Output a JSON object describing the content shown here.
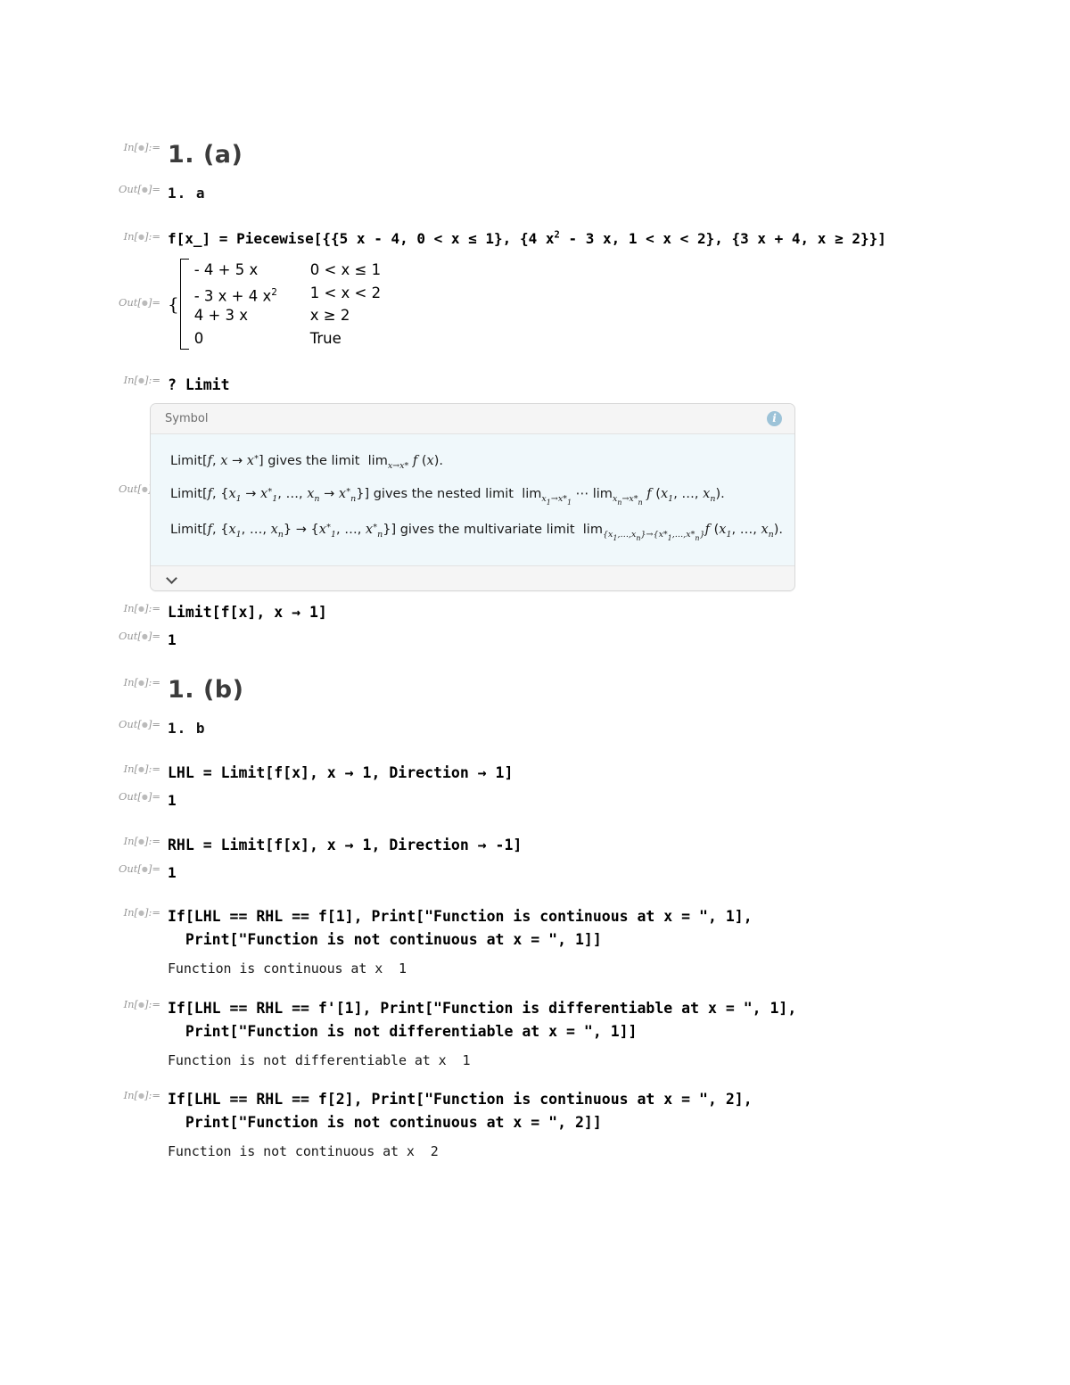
{
  "notebook": {
    "in_label": "In[",
    "out_label": "Out[",
    "label_suffix_in": "]:=",
    "label_suffix_out": "]="
  },
  "cells": {
    "title_a_in": "1. (a)",
    "title_a_out": "1. a",
    "piecewise_in": "f[x_] = Piecewise[{{5 x - 4, 0 < x ≤ 1}, {4 x² - 3 x, 1 < x < 2}, {3 x + 4, x ≥ 2}}]",
    "piecewise_out": {
      "rows": [
        {
          "expr": "- 4 + 5 x",
          "cond": "0 < x ≤ 1"
        },
        {
          "expr": "- 3 x + 4 x",
          "expr_sup": "2",
          "cond": "1 < x < 2"
        },
        {
          "expr": "4 + 3 x",
          "cond": "x ≥ 2"
        },
        {
          "expr": "0",
          "cond": "True"
        }
      ]
    },
    "help_in": "? Limit",
    "limit_in": "Limit[f[x], x → 1]",
    "limit_out": "1",
    "title_b_in": "1. (b)",
    "title_b_out": "1. b",
    "lhl_in": "LHL = Limit[f[x], x → 1, Direction → 1]",
    "lhl_out": "1",
    "rhl_in": "RHL = Limit[f[x], x → 1, Direction → -1]",
    "rhl_out": "1",
    "if_cont1_in_line1": "If[LHL == RHL == f[1], Print[\"Function is continuous at x = \", 1],",
    "if_cont1_in_line2": "  Print[\"Function is not continuous at x = \", 1]]",
    "if_cont1_print": "Function is continuous at x  1",
    "if_diff_in_line1": "If[LHL == RHL == f'[1], Print[\"Function is differentiable at x = \", 1],",
    "if_diff_in_line2": "  Print[\"Function is not differentiable at x = \", 1]]",
    "if_diff_print": "Function is not differentiable at x  1",
    "if_cont2_in_line1": "If[LHL == RHL == f[2], Print[\"Function is continuous at x = \", 2],",
    "if_cont2_in_line2": "  Print[\"Function is not continuous at x = \", 2]]",
    "if_cont2_print": "Function is not continuous at x  2"
  },
  "docbox": {
    "header_label": "Symbol",
    "info_icon": "info-icon",
    "expand_icon": "chevron-down-icon",
    "lines": [
      {
        "id": "single-limit",
        "text": "Limit[f, x → x*] gives the limit  lim_{x→x*} f (x)."
      },
      {
        "id": "nested-limit",
        "text": "Limit[f, {x₁ → x*₁, …, xₙ → x*ₙ}] gives the nested limit  lim_{x₁→x*₁} ⋯ lim_{xₙ→x*ₙ} f (x₁, …, xₙ)."
      },
      {
        "id": "multivariate-limit",
        "text": "Limit[f, {x₁, …, xₙ} → {x*₁, …, x*ₙ}] gives the multivariate limit  lim_{{x₁,…,xₙ}→{x*₁,…,x*ₙ}} f (x₁, …, xₙ)."
      }
    ]
  },
  "colors": {
    "doc_body_bg": "#f0f8fb",
    "doc_header_bg": "#f5f5f5",
    "doc_border": "#d8d8d8",
    "info_icon_bg": "#9dc3d8",
    "label_gray": "#999999",
    "title_gray": "#3b3b3b"
  }
}
